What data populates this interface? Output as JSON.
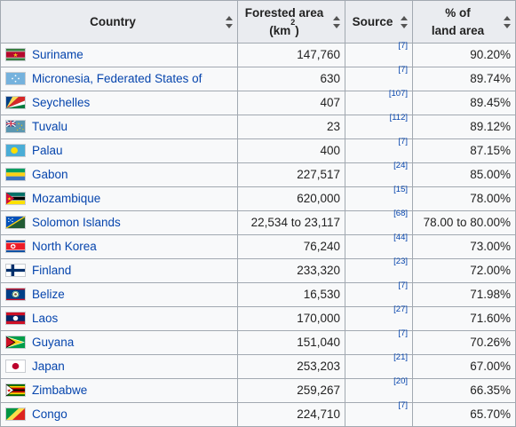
{
  "header": {
    "country": "Country",
    "forested_area": "Forested area",
    "unit_prefix": "(km",
    "unit_sup": "2",
    "unit_suffix": ")",
    "source": "Source",
    "pct_line1": "% of",
    "pct_line2": "land area"
  },
  "rows": [
    {
      "country": "Suriname",
      "flag": "suriname-flag-icon",
      "area": "147,760",
      "source": "[7]",
      "pct": "90.20%"
    },
    {
      "country": "Micronesia, Federated States of",
      "flag": "micronesia-flag-icon",
      "area": "630",
      "source": "[7]",
      "pct": "89.74%"
    },
    {
      "country": "Seychelles",
      "flag": "seychelles-flag-icon",
      "area": "407",
      "source": "[107]",
      "pct": "89.45%"
    },
    {
      "country": "Tuvalu",
      "flag": "tuvalu-flag-icon",
      "area": "23",
      "source": "[112]",
      "pct": "89.12%"
    },
    {
      "country": "Palau",
      "flag": "palau-flag-icon",
      "area": "400",
      "source": "[7]",
      "pct": "87.15%"
    },
    {
      "country": "Gabon",
      "flag": "gabon-flag-icon",
      "area": "227,517",
      "source": "[24]",
      "pct": "85.00%"
    },
    {
      "country": "Mozambique",
      "flag": "mozambique-flag-icon",
      "area": "620,000",
      "source": "[15]",
      "pct": "78.00%"
    },
    {
      "country": "Solomon Islands",
      "flag": "solomon-islands-flag-icon",
      "area": "22,534 to 23,117",
      "source": "[68]",
      "pct": "78.00 to 80.00%"
    },
    {
      "country": "North Korea",
      "flag": "north-korea-flag-icon",
      "area": "76,240",
      "source": "[44]",
      "pct": "73.00%"
    },
    {
      "country": "Finland",
      "flag": "finland-flag-icon",
      "area": "233,320",
      "source": "[23]",
      "pct": "72.00%"
    },
    {
      "country": "Belize",
      "flag": "belize-flag-icon",
      "area": "16,530",
      "source": "[7]",
      "pct": "71.98%"
    },
    {
      "country": "Laos",
      "flag": "laos-flag-icon",
      "area": "170,000",
      "source": "[27]",
      "pct": "71.60%"
    },
    {
      "country": "Guyana",
      "flag": "guyana-flag-icon",
      "area": "151,040",
      "source": "[7]",
      "pct": "70.26%"
    },
    {
      "country": "Japan",
      "flag": "japan-flag-icon",
      "area": "253,203",
      "source": "[21]",
      "pct": "67.00%"
    },
    {
      "country": "Zimbabwe",
      "flag": "zimbabwe-flag-icon",
      "area": "259,267",
      "source": "[20]",
      "pct": "66.35%"
    },
    {
      "country": "Congo",
      "flag": "congo-flag-icon",
      "area": "224,710",
      "source": "[7]",
      "pct": "65.70%"
    }
  ],
  "colors": {
    "link": "#0645ad",
    "header_bg": "#eaecf0",
    "cell_bg": "#f8f9fa",
    "border": "#a2a9b1"
  }
}
